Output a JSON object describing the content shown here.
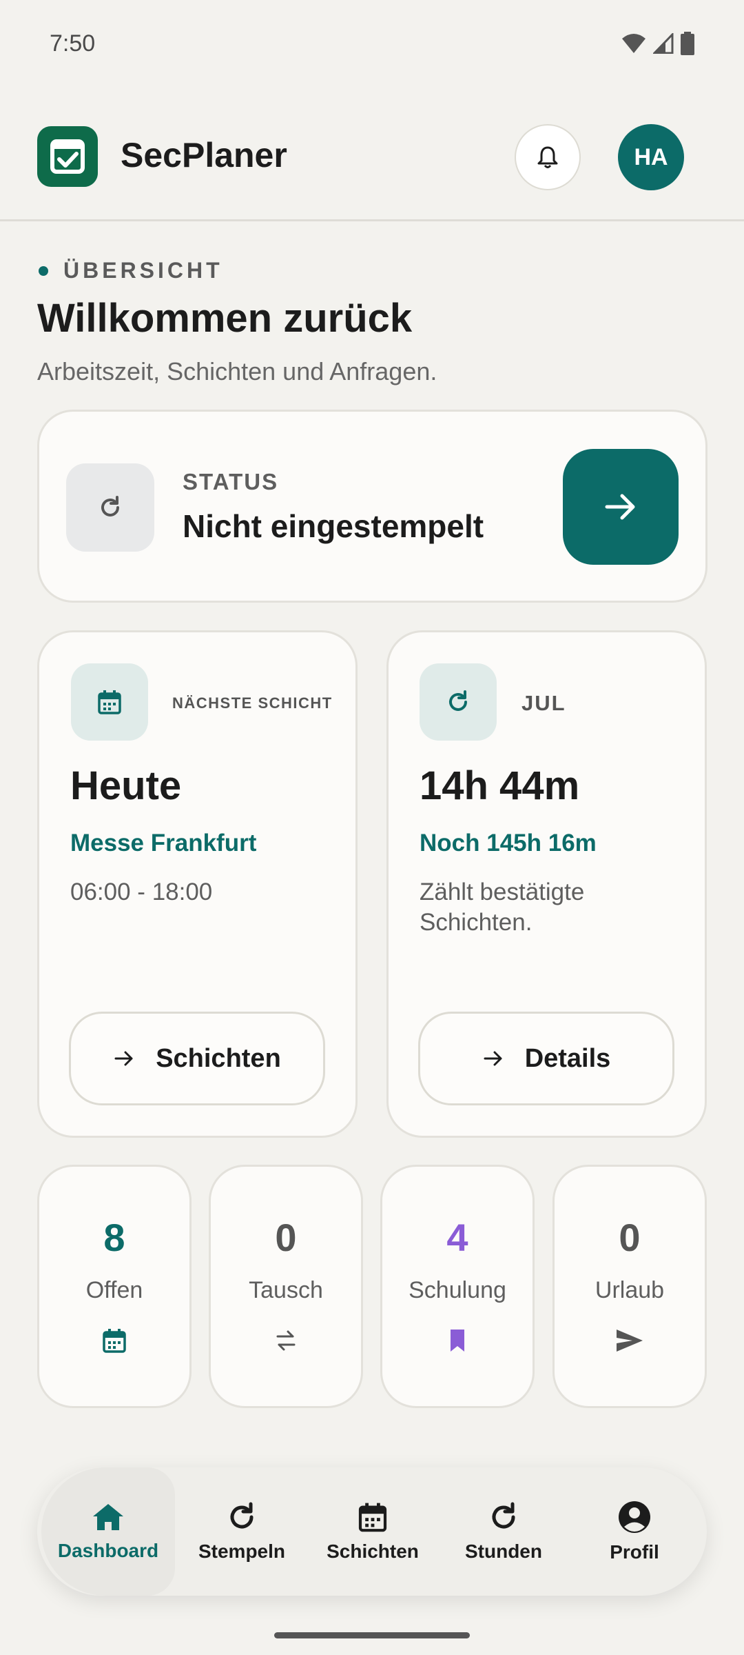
{
  "status_bar": {
    "time": "7:50"
  },
  "app_bar": {
    "title": "SecPlaner",
    "avatar_initials": "HA"
  },
  "overview": {
    "eyebrow": "ÜBERSICHT",
    "title": "Willkommen zurück",
    "subtitle": "Arbeitszeit, Schichten und Anfragen."
  },
  "status_card": {
    "label": "STATUS",
    "value": "Nicht eingestempelt"
  },
  "next_shift": {
    "label": "NÄCHSTE SCHICHT",
    "day": "Heute",
    "location": "Messe Frankfurt",
    "time": "06:00 - 18:00",
    "button": "Schichten"
  },
  "hours": {
    "label": "JUL",
    "value": "14h 44m",
    "remaining": "Noch 145h 16m",
    "note": "Zählt bestätigte Schichten.",
    "button": "Details"
  },
  "stats": {
    "open": {
      "count": "8",
      "label": "Offen",
      "color": "#0c6b68",
      "icon": "calendar-icon"
    },
    "swap": {
      "count": "0",
      "label": "Tausch",
      "color": "#555555",
      "icon": "swap-icon"
    },
    "training": {
      "count": "4",
      "label": "Schulung",
      "color": "#8a5cd6",
      "icon": "bookmark-icon"
    },
    "vacation": {
      "count": "0",
      "label": "Urlaub",
      "color": "#555555",
      "icon": "send-icon"
    }
  },
  "nav": {
    "dashboard": "Dashboard",
    "stempeln": "Stempeln",
    "schichten": "Schichten",
    "stunden": "Stunden",
    "profil": "Profil"
  },
  "colors": {
    "accent": "#0c6b68",
    "brand": "#0e6b4a",
    "training": "#8a5cd6"
  }
}
